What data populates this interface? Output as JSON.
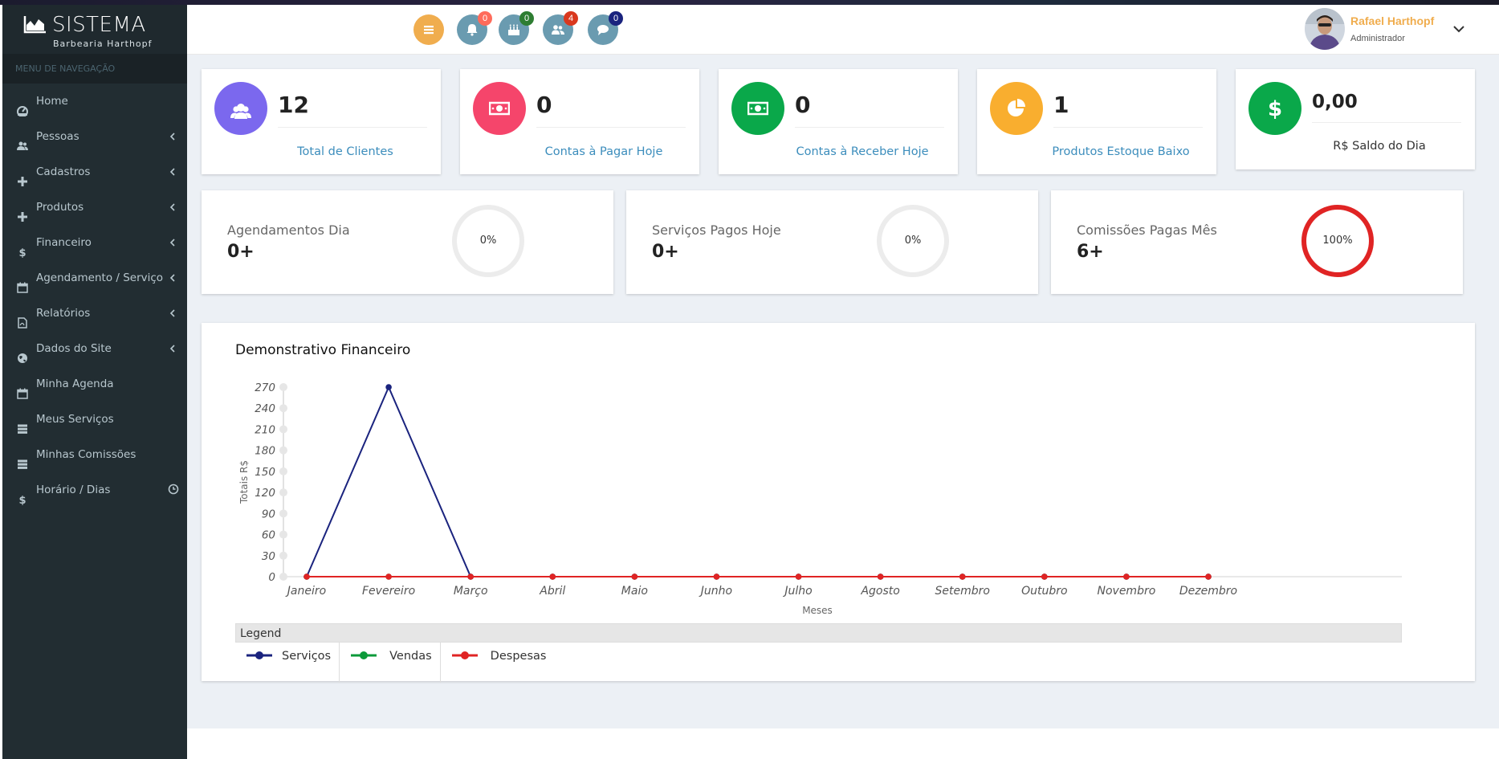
{
  "app": {
    "title": "SISTEMA",
    "subtitle": "Barbearia Harthopf"
  },
  "sidebar": {
    "header": "MENU DE NAVEGAÇÃO",
    "items": [
      {
        "label": "Home",
        "icon": "dashboard-icon",
        "has_submenu": false
      },
      {
        "label": "Pessoas",
        "icon": "users-icon",
        "has_submenu": true
      },
      {
        "label": "Cadastros",
        "icon": "plus-icon",
        "has_submenu": true
      },
      {
        "label": "Produtos",
        "icon": "plus-icon",
        "has_submenu": true
      },
      {
        "label": "Financeiro",
        "icon": "dollar-icon",
        "has_submenu": true
      },
      {
        "label": "Agendamento / Serviço",
        "icon": "calendar-icon",
        "has_submenu": true
      },
      {
        "label": "Relatórios",
        "icon": "pdf-file-icon",
        "has_submenu": true
      },
      {
        "label": "Dados do Site",
        "icon": "globe-icon",
        "has_submenu": true
      },
      {
        "label": "Minha Agenda",
        "icon": "calendar-icon",
        "has_submenu": false
      },
      {
        "label": "Meus Serviços",
        "icon": "server-icon",
        "has_submenu": false
      },
      {
        "label": "Minhas Comissões",
        "icon": "server-icon",
        "has_submenu": false
      },
      {
        "label": "Horário / Dias",
        "icon": "dollar-icon",
        "has_submenu": false
      }
    ]
  },
  "header": {
    "buttons": [
      {
        "icon": "menu-icon",
        "color": "#f0ad4e"
      },
      {
        "icon": "bell-icon",
        "badge": "0",
        "badge_color": "#ff6b5b",
        "color": "#6a9bb0"
      },
      {
        "icon": "birthday-cake-icon",
        "badge": "0",
        "badge_color": "#2e7d32",
        "color": "#6a9bb0"
      },
      {
        "icon": "users-icon",
        "badge": "4",
        "badge_color": "#d9381e",
        "color": "#6a9bb0"
      },
      {
        "icon": "comment-icon",
        "badge": "0",
        "badge_color": "#1a237e",
        "color": "#6a9bb0"
      }
    ],
    "user": {
      "name": "Rafael Harthopf",
      "role": "Administrador"
    }
  },
  "stats": [
    {
      "value": "12",
      "label": "Total de Clientes",
      "color": "#7b68ee",
      "icon": "users-icon",
      "linked": true
    },
    {
      "value": "0",
      "label": "Contas à Pagar Hoje",
      "color": "#f5456b",
      "icon": "money-bill-icon",
      "linked": true
    },
    {
      "value": "0",
      "label": "Contas à Receber Hoje",
      "color": "#0aa84a",
      "icon": "money-bill-icon",
      "linked": true
    },
    {
      "value": "1",
      "label": "Produtos Estoque Baixo",
      "color": "#f9ae2f",
      "icon": "pie-chart-icon",
      "linked": true
    },
    {
      "value": "0,00",
      "label": "R$ Saldo do Dia",
      "color": "#0aa84a",
      "icon": "dollar-icon",
      "linked": false
    }
  ],
  "progress": [
    {
      "label": "Agendamentos Dia",
      "value": "0+",
      "percent_text": "0%",
      "percent": 0,
      "ring_color": "#ececec"
    },
    {
      "label": "Serviços Pagos Hoje",
      "value": "0+",
      "percent_text": "0%",
      "percent": 0,
      "ring_color": "#ececec"
    },
    {
      "label": "Comissões Pagas Mês",
      "value": "6+",
      "percent_text": "100%",
      "percent": 100,
      "ring_color": "#e02424"
    }
  ],
  "chart": {
    "title": "Demonstrativo Financeiro",
    "legend_title": "Legend"
  },
  "chart_data": {
    "type": "line",
    "xlabel": "Meses",
    "ylabel": "Totais R$",
    "categories": [
      "Janeiro",
      "Fevereiro",
      "Março",
      "Abril",
      "Maio",
      "Junho",
      "Julho",
      "Agosto",
      "Setembro",
      "Outubro",
      "Novembro",
      "Dezembro"
    ],
    "yticks": [
      0,
      30,
      60,
      90,
      120,
      150,
      180,
      210,
      240,
      270
    ],
    "ylim": [
      0,
      270
    ],
    "series": [
      {
        "name": "Serviços",
        "color": "#1a237e",
        "values": [
          0,
          270,
          0,
          0,
          0,
          0,
          0,
          0,
          0,
          0,
          0,
          0
        ]
      },
      {
        "name": "Vendas",
        "color": "#0c9a3a",
        "values": [
          0,
          0,
          0,
          0,
          0,
          0,
          0,
          0,
          0,
          0,
          0,
          0
        ]
      },
      {
        "name": "Despesas",
        "color": "#e02424",
        "values": [
          0,
          0,
          0,
          0,
          0,
          0,
          0,
          0,
          0,
          0,
          0,
          0
        ]
      }
    ],
    "legend_position": "bottom"
  }
}
